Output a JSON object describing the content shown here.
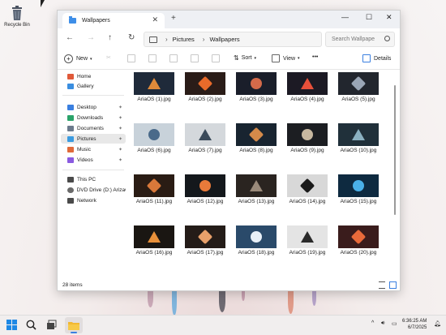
{
  "desktop": {
    "recycle_bin_label": "Recycle Bin"
  },
  "window": {
    "tab_title": "Wallpapers",
    "tab_close": "✕",
    "new_tab": "+",
    "controls": {
      "minimize": "—",
      "maximize": "☐",
      "close": "✕"
    },
    "nav": {
      "back": "←",
      "forward": "→",
      "up": "↑",
      "refresh": "↻"
    },
    "address": {
      "crumbs": [
        "Pictures",
        "Wallpapers"
      ],
      "separator": "›"
    },
    "search_placeholder": "Search Wallpape",
    "commands": {
      "new": "New",
      "sort": "Sort",
      "view": "View",
      "more": "•••",
      "details": "Details"
    },
    "sidebar": {
      "items": [
        {
          "label": "Home",
          "color": "#e05a3a"
        },
        {
          "label": "Gallery",
          "color": "#3a8ee0"
        },
        {
          "label": "Desktop",
          "color": "#3a7fe0",
          "pinned": true
        },
        {
          "label": "Downloads",
          "color": "#2aa36a",
          "pinned": true
        },
        {
          "label": "Documents",
          "color": "#6b7a8c",
          "pinned": true
        },
        {
          "label": "Pictures",
          "color": "#3a9be0",
          "pinned": true
        },
        {
          "label": "Music",
          "color": "#e06a3a",
          "pinned": true
        },
        {
          "label": "Videos",
          "color": "#8a5ae0",
          "pinned": true
        },
        {
          "label": "This PC",
          "color": "#4a4a4a"
        },
        {
          "label": "DVD Drive (D:) ArizaOS",
          "color": "#6a6a6a"
        },
        {
          "label": "Network",
          "color": "#4a4a4a"
        }
      ],
      "pin_glyph": "📌"
    },
    "files": [
      {
        "name": "AriaOS (1).jpg",
        "bg": "#1f2a3a",
        "fg": "#e08a3a"
      },
      {
        "name": "AriaOS (2).jpg",
        "bg": "#2a1c18",
        "fg": "#e86a2a"
      },
      {
        "name": "AriaOS (3).jpg",
        "bg": "#1a1e2a",
        "fg": "#d46a4a"
      },
      {
        "name": "AriaOS (4).jpg",
        "bg": "#1c1a24",
        "fg": "#e8503a"
      },
      {
        "name": "AriaOS (5).jpg",
        "bg": "#22262e",
        "fg": "#9aa6b6"
      },
      {
        "name": "AriaOS (6).jpg",
        "bg": "#c8d2da",
        "fg": "#4a6a8a"
      },
      {
        "name": "AriaOS (7).jpg",
        "bg": "#d4d8dc",
        "fg": "#3a4a5a"
      },
      {
        "name": "AriaOS (8).jpg",
        "bg": "#182430",
        "fg": "#d48a4a"
      },
      {
        "name": "AriaOS (9).jpg",
        "bg": "#1c1e22",
        "fg": "#c8b8a0"
      },
      {
        "name": "AriaOS (10).jpg",
        "bg": "#20303a",
        "fg": "#8ab0c0"
      },
      {
        "name": "AriaOS (11).jpg",
        "bg": "#2a1c14",
        "fg": "#d8783a"
      },
      {
        "name": "AriaOS (12).jpg",
        "bg": "#14181c",
        "fg": "#e87a3a"
      },
      {
        "name": "AriaOS (13).jpg",
        "bg": "#2a2420",
        "fg": "#9a8a7a"
      },
      {
        "name": "AriaOS (14).jpg",
        "bg": "#d8d8d8",
        "fg": "#1a1a1a"
      },
      {
        "name": "AriaOS (15).jpg",
        "bg": "#0e2a40",
        "fg": "#4ab0e8"
      },
      {
        "name": "AriaOS (16).jpg",
        "bg": "#1a1612",
        "fg": "#e8903a"
      },
      {
        "name": "AriaOS (17).jpg",
        "bg": "#241c18",
        "fg": "#e8a06a"
      },
      {
        "name": "AriaOS (18).jpg",
        "bg": "#2a4a6a",
        "fg": "#e8f0f8"
      },
      {
        "name": "AriaOS (19).jpg",
        "bg": "#e4e4e4",
        "fg": "#2a2a2a"
      },
      {
        "name": "AriaOS (20).jpg",
        "bg": "#3a1c1c",
        "fg": "#e86a3a"
      }
    ],
    "status": {
      "item_count": "28 items"
    }
  },
  "taskbar": {
    "tray": {
      "chevron": "^",
      "clock_time": "6:36:25 AM",
      "clock_date": "6/7/2025"
    }
  }
}
